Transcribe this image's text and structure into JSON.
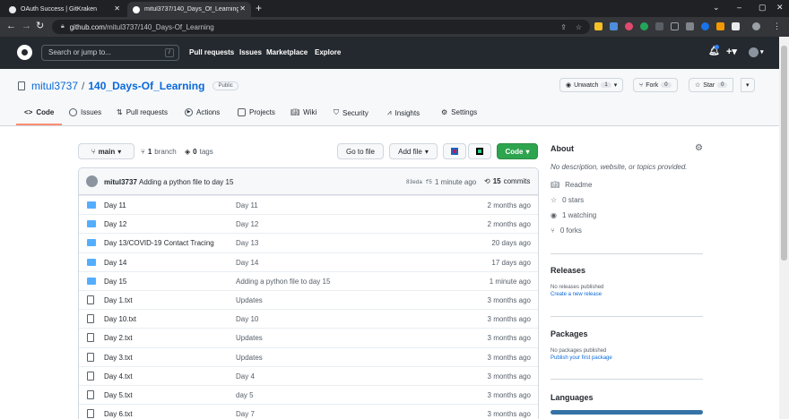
{
  "browser": {
    "tabs": [
      {
        "title": "OAuth Success | GitKraken",
        "active": false
      },
      {
        "title": "mitul3737/140_Days_Of_Learning",
        "active": true
      }
    ],
    "url_host": "github.com",
    "url_path": "/mitul3737/140_Days-Of_Learning"
  },
  "header": {
    "search_placeholder": "Search or jump to...",
    "search_key": "/",
    "links": [
      "Pull requests",
      "Issues",
      "Marketplace",
      "Explore"
    ]
  },
  "repo": {
    "owner": "mitul3737",
    "name": "140_Days-Of_Learning",
    "visibility": "Public",
    "watch_label": "Unwatch",
    "watch_count": "1",
    "fork_label": "Fork",
    "fork_count": "0",
    "star_label": "Star",
    "star_count": "0"
  },
  "tabs": [
    "Code",
    "Issues",
    "Pull requests",
    "Actions",
    "Projects",
    "Wiki",
    "Security",
    "Insights",
    "Settings"
  ],
  "toolbar": {
    "branch": "main",
    "branch_count": "1",
    "branch_label": "branch",
    "tags_count": "0",
    "tags_label": "tags",
    "goto_file": "Go to file",
    "add_file": "Add file",
    "code": "Code"
  },
  "commit": {
    "author": "mitul3737",
    "message": "Adding a python file to day 15",
    "sha": "83eda f5",
    "time": "1 minute ago",
    "count": "15",
    "count_label": "commits"
  },
  "files": [
    {
      "type": "dir",
      "name": "Day 11",
      "message": "Day 11",
      "age": "2 months ago"
    },
    {
      "type": "dir",
      "name": "Day 12",
      "message": "Day 12",
      "age": "2 months ago"
    },
    {
      "type": "dir",
      "name": "Day 13/COVID-19 Contact Tracing",
      "message": "Day 13",
      "age": "20 days ago"
    },
    {
      "type": "dir",
      "name": "Day 14",
      "message": "Day 14",
      "age": "17 days ago"
    },
    {
      "type": "dir",
      "name": "Day 15",
      "message": "Adding a python file to day 15",
      "age": "1 minute ago"
    },
    {
      "type": "file",
      "name": "Day 1.txt",
      "message": "Updates",
      "age": "3 months ago"
    },
    {
      "type": "file",
      "name": "Day 10.txt",
      "message": "Day 10",
      "age": "3 months ago"
    },
    {
      "type": "file",
      "name": "Day 2.txt",
      "message": "Updates",
      "age": "3 months ago"
    },
    {
      "type": "file",
      "name": "Day 3.txt",
      "message": "Updates",
      "age": "3 months ago"
    },
    {
      "type": "file",
      "name": "Day 4.txt",
      "message": "Day 4",
      "age": "3 months ago"
    },
    {
      "type": "file",
      "name": "Day 5.txt",
      "message": "day 5",
      "age": "3 months ago"
    },
    {
      "type": "file",
      "name": "Day 6.txt",
      "message": "Day 7",
      "age": "3 months ago"
    }
  ],
  "about": {
    "title": "About",
    "description": "No description, website, or topics provided.",
    "readme": "Readme",
    "stars": "0 stars",
    "watching": "1 watching",
    "forks": "0 forks"
  },
  "releases": {
    "title": "Releases",
    "none": "No releases published",
    "create": "Create a new release"
  },
  "packages": {
    "title": "Packages",
    "none": "No packages published",
    "publish": "Publish your first package"
  },
  "languages": {
    "title": "Languages",
    "bar_color": "#3572A5"
  }
}
